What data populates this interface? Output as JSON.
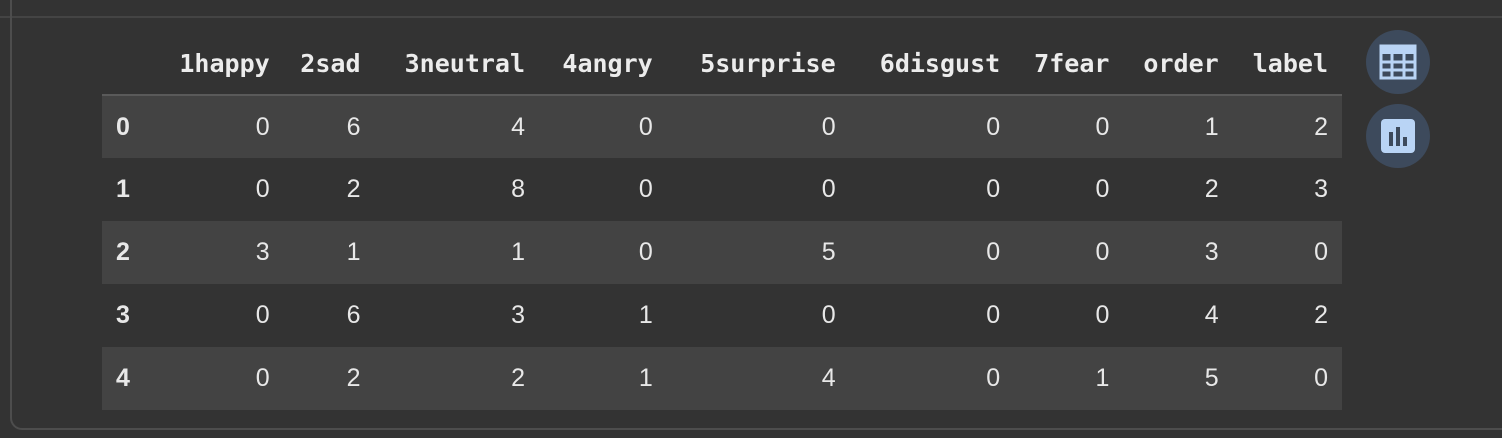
{
  "table": {
    "columns": [
      "1happy",
      "2sad",
      "3neutral",
      "4angry",
      "5surprise",
      "6disgust",
      "7fear",
      "order",
      "label"
    ],
    "rows": [
      {
        "index": "0",
        "cells": [
          "0",
          "6",
          "4",
          "0",
          "0",
          "0",
          "0",
          "1",
          "2"
        ]
      },
      {
        "index": "1",
        "cells": [
          "0",
          "2",
          "8",
          "0",
          "0",
          "0",
          "0",
          "2",
          "3"
        ]
      },
      {
        "index": "2",
        "cells": [
          "3",
          "1",
          "1",
          "0",
          "5",
          "0",
          "0",
          "3",
          "0"
        ]
      },
      {
        "index": "3",
        "cells": [
          "0",
          "6",
          "3",
          "1",
          "0",
          "0",
          "0",
          "4",
          "2"
        ]
      },
      {
        "index": "4",
        "cells": [
          "0",
          "2",
          "2",
          "1",
          "4",
          "0",
          "1",
          "5",
          "0"
        ]
      }
    ]
  },
  "buttons": {
    "table_icon": "table-icon",
    "chart_icon": "bar-chart-icon"
  },
  "colors": {
    "background": "#333333",
    "row_stripe": "#434343",
    "button_bg": "#3d4a5c",
    "icon_accent": "#b9d4f5"
  }
}
